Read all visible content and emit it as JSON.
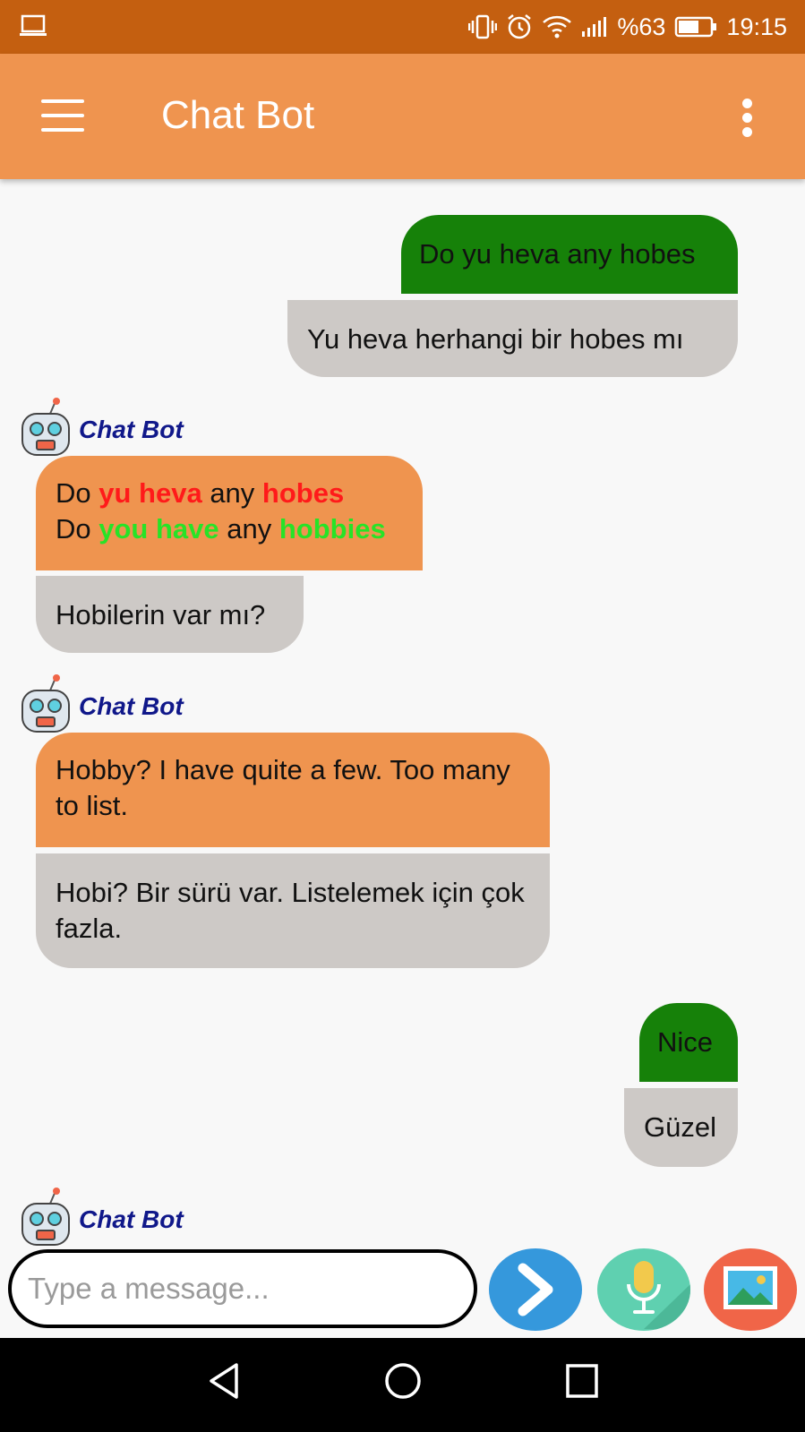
{
  "status_bar": {
    "battery": "%63",
    "time": "19:15",
    "icons": [
      "laptop-icon",
      "vibrate-icon",
      "alarm-icon",
      "wifi-icon",
      "signal-icon",
      "battery-icon"
    ]
  },
  "app_bar": {
    "title": "Chat Bot",
    "icons": [
      "menu-icon",
      "more-vertical-icon"
    ]
  },
  "colors": {
    "status_bar": "#c45f10",
    "app_bar": "#ef944f",
    "user_bubble": "#168109",
    "bot_bubble": "#ef944f",
    "translation_bubble": "#cdc9c6",
    "bot_name": "#10188a",
    "highlight_wrong": "#ff1a1a",
    "highlight_correct": "#27e327"
  },
  "messages": [
    {
      "sender": "user",
      "text": "Do yu heva any hobes",
      "translation": "Yu heva herhangi bir hobes mı"
    },
    {
      "sender": "bot",
      "name": "Chat Bot",
      "line1": [
        {
          "t": "Do ",
          "style": "plain"
        },
        {
          "t": "yu heva",
          "style": "wrong"
        },
        {
          "t": " any ",
          "style": "plain"
        },
        {
          "t": "hobes",
          "style": "wrong"
        }
      ],
      "line2": [
        {
          "t": "Do ",
          "style": "plain"
        },
        {
          "t": "you have",
          "style": "correct"
        },
        {
          "t": " any ",
          "style": "plain"
        },
        {
          "t": "hobbies",
          "style": "correct"
        }
      ],
      "translation": "Hobilerin var mı?"
    },
    {
      "sender": "bot",
      "name": "Chat Bot",
      "text": "Hobby? I have quite a few. Too many to list.",
      "translation": "Hobi? Bir sürü var. Listelemek için çok fazla."
    },
    {
      "sender": "user",
      "text": "Nice",
      "translation": "Güzel"
    },
    {
      "sender": "bot",
      "name": "Chat Bot"
    }
  ],
  "composer": {
    "placeholder": "Type a message...",
    "value": "",
    "buttons": [
      "send-icon",
      "microphone-icon",
      "image-icon"
    ]
  },
  "nav_bar": {
    "icons": [
      "back-icon",
      "home-icon",
      "recents-icon"
    ]
  }
}
